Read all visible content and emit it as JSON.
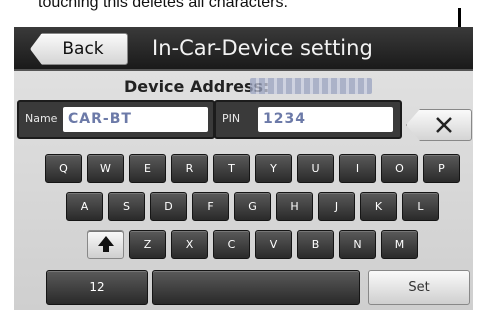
{
  "annotation": {
    "caption": "touching this deletes all characters."
  },
  "header": {
    "back_label": "Back",
    "title": "In-Car-Device setting"
  },
  "device": {
    "address_label": "Device Address:"
  },
  "fields": {
    "name_label": "Name",
    "name_value": "CAR-BT",
    "pin_label": "PIN",
    "pin_value": "1234"
  },
  "keyboard": {
    "row1": [
      "Q",
      "W",
      "E",
      "R",
      "T",
      "Y",
      "U",
      "I",
      "O",
      "P"
    ],
    "row2": [
      "A",
      "S",
      "D",
      "F",
      "G",
      "H",
      "J",
      "K",
      "L"
    ],
    "row3": [
      "Z",
      "X",
      "C",
      "V",
      "B",
      "N",
      "M"
    ],
    "numbers_label": "12",
    "set_label": "Set"
  },
  "icons": {
    "delete": "delete-all-icon",
    "shift": "shift-arrow-icon"
  }
}
